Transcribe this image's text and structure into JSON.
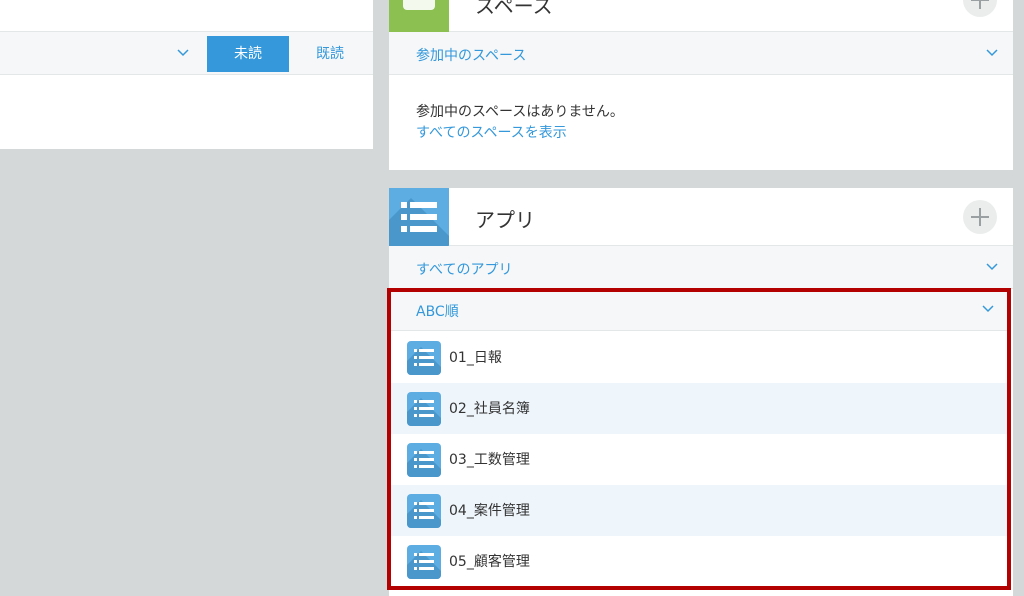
{
  "notifications": {
    "unread_label": "未読",
    "read_label": "既読"
  },
  "space_widget": {
    "title": "スペース",
    "section_label": "参加中のスペース",
    "empty_message": "参加中のスペースはありません。",
    "show_all_link": "すべてのスペースを表示"
  },
  "app_widget": {
    "title": "アプリ",
    "all_apps_label": "すべてのアプリ",
    "sort_label": "ABC順",
    "apps": [
      {
        "label": "01_日報",
        "icon": "app-list-icon"
      },
      {
        "label": "02_社員名簿",
        "icon": "app-list-icon"
      },
      {
        "label": "03_工数管理",
        "icon": "app-list-icon"
      },
      {
        "label": "04_案件管理",
        "icon": "app-list-icon"
      },
      {
        "label": "05_顧客管理",
        "icon": "app-list-icon"
      }
    ]
  },
  "colors": {
    "accent": "#3498db",
    "space_green": "#8cc152",
    "app_blue": "#5dade2",
    "highlight_red": "#b30000"
  }
}
